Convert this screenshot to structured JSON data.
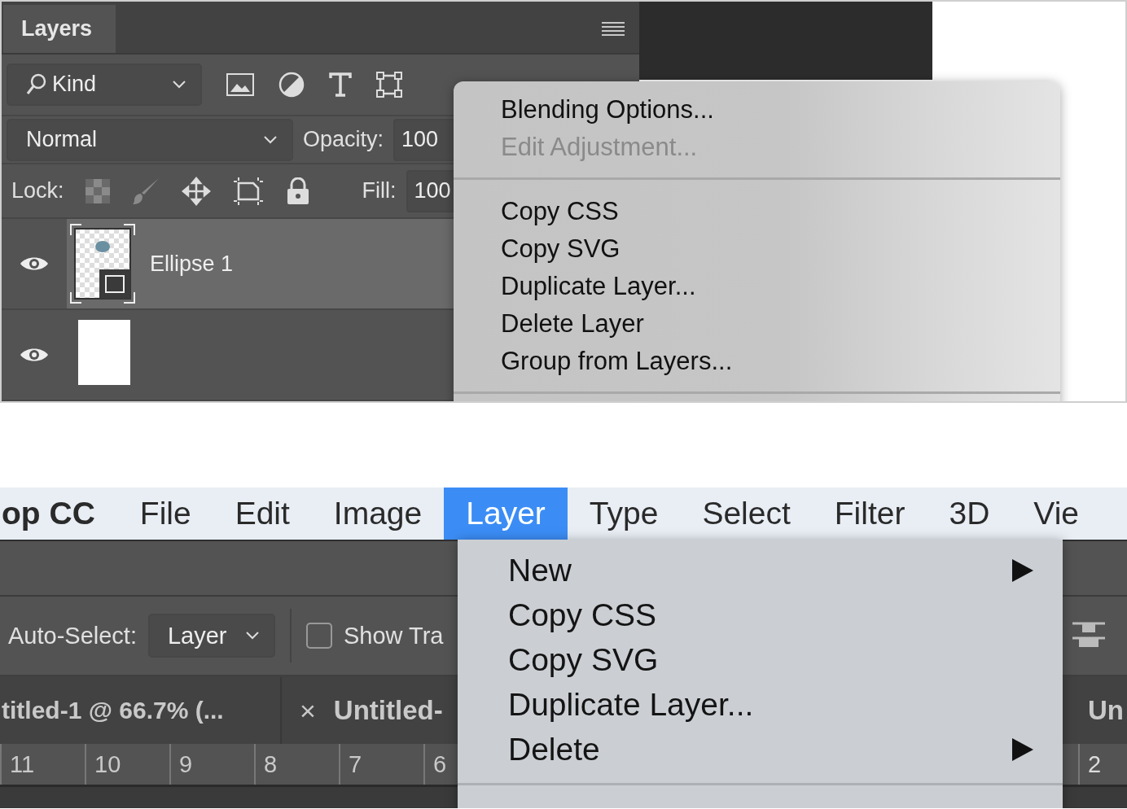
{
  "layers_panel": {
    "tab": "Layers",
    "filter": {
      "label": "Kind"
    },
    "blend_mode": {
      "value": "Normal"
    },
    "opacity": {
      "label": "Opacity:",
      "value": "100"
    },
    "lock": {
      "label": "Lock:"
    },
    "fill": {
      "label": "Fill:",
      "value": "100"
    },
    "layers": [
      {
        "name": "Ellipse 1",
        "visible": true,
        "selected": true,
        "kind": "shape"
      },
      {
        "visible": true,
        "selected": false,
        "kind": "white"
      }
    ]
  },
  "context_menu": {
    "items": [
      {
        "kind": "item",
        "label": "Blending Options...",
        "disabled": false
      },
      {
        "kind": "item",
        "label": "Edit Adjustment...",
        "disabled": true
      },
      {
        "kind": "separator"
      },
      {
        "kind": "item",
        "label": "Copy CSS",
        "disabled": false
      },
      {
        "kind": "item",
        "label": "Copy SVG",
        "disabled": false
      },
      {
        "kind": "item",
        "label": "Duplicate Layer...",
        "disabled": false
      },
      {
        "kind": "item",
        "label": "Delete Layer",
        "disabled": false
      },
      {
        "kind": "item",
        "label": "Group from Layers...",
        "disabled": false
      },
      {
        "kind": "separator"
      }
    ]
  },
  "menu_bar": {
    "items": [
      {
        "label": "op CC",
        "kind": "app",
        "selected": false
      },
      {
        "label": "File",
        "kind": "menu",
        "selected": false
      },
      {
        "label": "Edit",
        "kind": "menu",
        "selected": false
      },
      {
        "label": "Image",
        "kind": "menu",
        "selected": false
      },
      {
        "label": "Layer",
        "kind": "menu",
        "selected": true
      },
      {
        "label": "Type",
        "kind": "menu",
        "selected": false
      },
      {
        "label": "Select",
        "kind": "menu",
        "selected": false
      },
      {
        "label": "Filter",
        "kind": "menu",
        "selected": false
      },
      {
        "label": "3D",
        "kind": "menu",
        "selected": false
      },
      {
        "label": "Vie",
        "kind": "menu",
        "selected": false
      }
    ]
  },
  "options_bar": {
    "auto_select": {
      "label": "Auto-Select:",
      "value": "Layer"
    },
    "show_transform": {
      "label": "Show Tra",
      "checked": false
    }
  },
  "document_tabs": [
    {
      "label": "titled-1 @ 66.7% (..."
    },
    {
      "label": "Untitled-",
      "close": "×"
    },
    {
      "label": "Un"
    }
  ],
  "ruler": {
    "labels": [
      "11",
      "10",
      "9",
      "8",
      "7",
      "6"
    ],
    "right_labels": [
      "2"
    ]
  },
  "layer_menu": {
    "items": [
      {
        "kind": "item",
        "label": "New",
        "submenu": true
      },
      {
        "kind": "item",
        "label": "Copy CSS",
        "submenu": false
      },
      {
        "kind": "item",
        "label": "Copy SVG",
        "submenu": false
      },
      {
        "kind": "item",
        "label": "Duplicate Layer...",
        "submenu": false
      },
      {
        "kind": "item",
        "label": "Delete",
        "submenu": true
      },
      {
        "kind": "separator"
      }
    ]
  }
}
